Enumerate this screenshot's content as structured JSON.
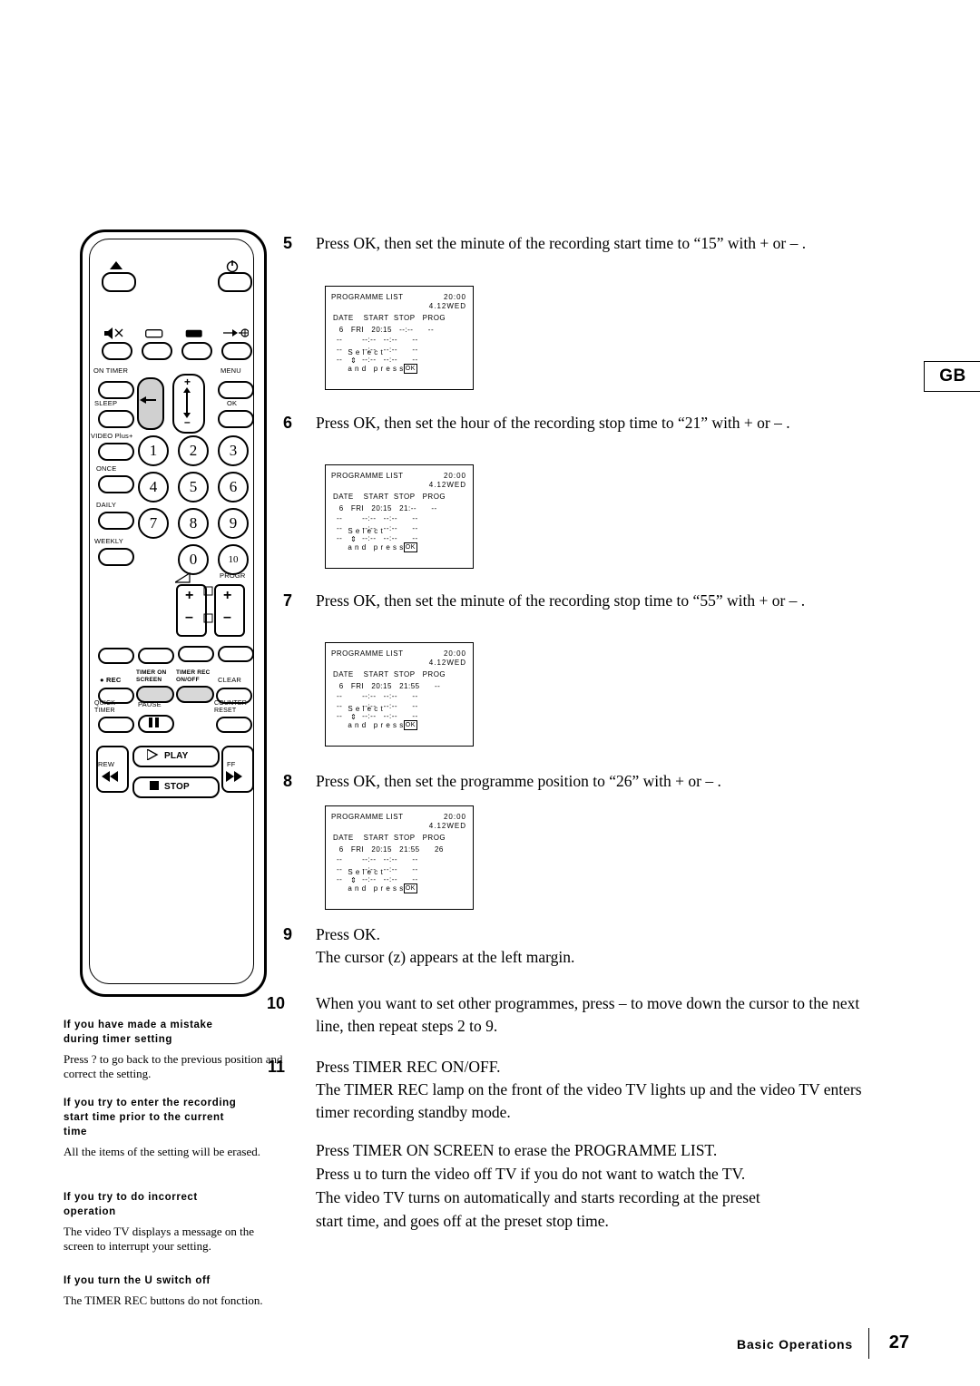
{
  "page": {
    "gb_tab": "GB",
    "footer_section": "Basic Operations",
    "footer_page": "27"
  },
  "remote": {
    "labels": {
      "on_timer": "ON TIMER",
      "menu": "MENU",
      "sleep": "SLEEP",
      "ok": "OK",
      "video_plus": "VIDEO Plus+",
      "once": "ONCE",
      "daily": "DAILY",
      "weekly": "WEEKLY",
      "progr": "PROGR",
      "rec": "REC",
      "timer_on_screen": "TIMER ON\nSCREEN",
      "timer_rec_onoff": "TIMER REC\nON/OFF",
      "clear": "CLEAR",
      "quick_timer": "QUICK\nTIMER",
      "pause": "PAUSE",
      "counter_reset": "COUNTER\nRESET",
      "rew": "REW",
      "play": "PLAY",
      "ff": "FF",
      "stop": "STOP"
    },
    "keys": [
      "1",
      "2",
      "3",
      "4",
      "5",
      "6",
      "7",
      "8",
      "9",
      "0"
    ]
  },
  "steps": [
    {
      "num": "5",
      "text": "Press OK, then set the minute of the recording start time to “15” with + or – ."
    },
    {
      "num": "6",
      "text": "Press OK, then set the hour of the recording stop time  to “21” with +  or – ."
    },
    {
      "num": "7",
      "text": "Press OK, then set the minute of the recording stop time to “55” with + or – ."
    },
    {
      "num": "8",
      "text": "Press OK, then set the programme position to “26” with +  or – ."
    },
    {
      "num": "9",
      "text": "Press OK.\nThe cursor (z) appears at the left margin."
    },
    {
      "num": "10",
      "text": "When you want to set other programmes, press –  to move down the cursor to the next line, then repeat steps 2 to 9."
    },
    {
      "num": "11",
      "text": "Press TIMER REC ON/OFF.\nThe TIMER REC lamp on the front of the video TV lights up and the video TV enters timer recording standby mode."
    }
  ],
  "closing": [
    "Press TIMER ON SCREEN to erase the PROGRAMME LIST.",
    "Press u to turn the video off TV if you do not want to watch the TV.",
    "The video TV turns on automatically and starts recording at the preset",
    "start time, and goes off at the preset stop time."
  ],
  "osd": {
    "title": "PROGRAMME LIST",
    "clock": "20:00",
    "date2": "4.12WED",
    "header": "DATE    START  STOP   PROG",
    "footer_prefix": "S e l e c t",
    "footer_mid": "a n d   p r e s s",
    "footer_ok": "OK",
    "blank_row": "--        --:--   --:--      --",
    "screens": [
      {
        "row1": " 6   FRI   20:15   --:--      --"
      },
      {
        "row1": " 6   FRI   20:15   21:--      --"
      },
      {
        "row1": " 6   FRI   20:15   21:55      --"
      },
      {
        "row1": " 6   FRI   20:15   21:55      26"
      }
    ]
  },
  "notes": [
    {
      "heading": "If you have made a mistake\nduring timer setting",
      "body": "Press ? to go back to the previous position and correct the setting."
    },
    {
      "heading": "If you try to enter the recording\nstart time prior to the current\ntime",
      "body": "All the items of the setting will be erased."
    },
    {
      "heading": "If you try to do incorrect\noperation",
      "body": "The video TV displays a message on the screen to interrupt your setting."
    },
    {
      "heading": "If you turn the U switch off",
      "body": "The TIMER REC buttons do not fonction."
    }
  ]
}
